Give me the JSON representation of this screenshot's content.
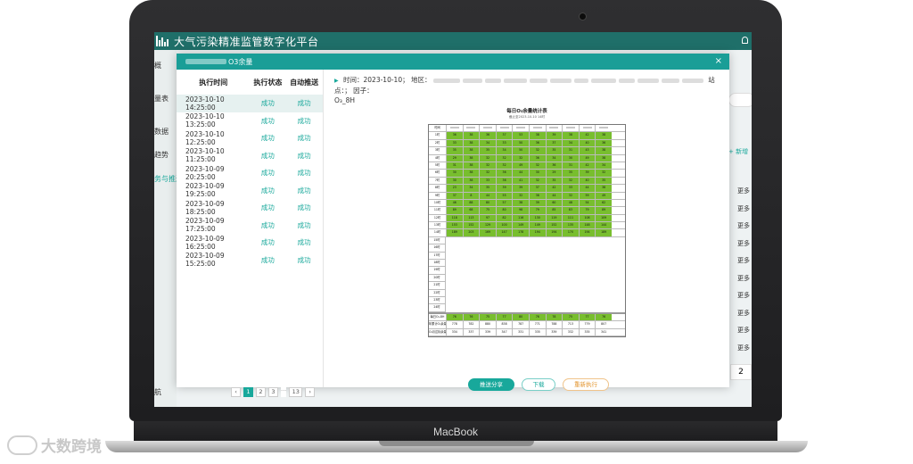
{
  "app": {
    "title": "大气污染精准监管数字化平台"
  },
  "sidebar": {
    "items": [
      {
        "label": "概"
      },
      {
        "label": "量表"
      },
      {
        "label": "数据"
      },
      {
        "label": "趋势"
      },
      {
        "label": "务与推送"
      },
      {
        "label": "航"
      }
    ]
  },
  "background": {
    "add_label": "+ 新增",
    "more_label": "更多",
    "page_label": "2"
  },
  "modal": {
    "title": "O3余量",
    "close": "×",
    "table": {
      "headers": {
        "time": "执行时间",
        "status": "执行状态",
        "push": "自动推送"
      },
      "rows": [
        {
          "time": "2023-10-10 14:25:00",
          "status": "成功",
          "push": "成功"
        },
        {
          "time": "2023-10-10 13:25:00",
          "status": "成功",
          "push": "成功"
        },
        {
          "time": "2023-10-10 12:25:00",
          "status": "成功",
          "push": "成功"
        },
        {
          "time": "2023-10-10 11:25:00",
          "status": "成功",
          "push": "成功"
        },
        {
          "time": "2023-10-09 20:25:00",
          "status": "成功",
          "push": "成功"
        },
        {
          "time": "2023-10-09 19:25:00",
          "status": "成功",
          "push": "成功"
        },
        {
          "time": "2023-10-09 18:25:00",
          "status": "成功",
          "push": "成功"
        },
        {
          "time": "2023-10-09 17:25:00",
          "status": "成功",
          "push": "成功"
        },
        {
          "time": "2023-10-09 16:25:00",
          "status": "成功",
          "push": "成功"
        },
        {
          "time": "2023-10-09 15:25:00",
          "status": "成功",
          "push": "成功"
        }
      ]
    },
    "pagination": {
      "prev": "‹",
      "pages": [
        "1",
        "2",
        "3"
      ],
      "ellipsis": "···",
      "last": "13",
      "next": "›",
      "current": "1"
    },
    "info": {
      "time_label": "时间：",
      "time_value": "2023-10-10；",
      "region_label": "地区：",
      "site_label": "站点：；",
      "factor_label": "因子：",
      "factor_value": "O₃_8H"
    },
    "report": {
      "title": "每日O₃余量统计表",
      "subtitle": "截止至2023-10-10 14时",
      "header_first": "时间",
      "hours": [
        "1时",
        "2时",
        "3时",
        "4时",
        "5时",
        "6时",
        "7时",
        "8时",
        "9时",
        "10时",
        "11时",
        "12时",
        "13时",
        "14时",
        "15时",
        "16时",
        "17时",
        "18时",
        "19时",
        "20时",
        "21时",
        "22时",
        "23时",
        "24时"
      ],
      "data": [
        [
          "36",
          "38",
          "36",
          "37",
          "53",
          "38",
          "39",
          "38",
          "42",
          "38"
        ],
        [
          "33",
          "38",
          "34",
          "33",
          "50",
          "36",
          "37",
          "34",
          "40",
          "36"
        ],
        [
          "35",
          "38",
          "35",
          "34",
          "50",
          "32",
          "35",
          "31",
          "43",
          "38"
        ],
        [
          "29",
          "38",
          "32",
          "32",
          "32",
          "36",
          "34",
          "30",
          "49",
          "38"
        ],
        [
          "31",
          "38",
          "32",
          "32",
          "49",
          "32",
          "36",
          "31",
          "42",
          "34"
        ],
        [
          "30",
          "38",
          "32",
          "36",
          "44",
          "30",
          "29",
          "35",
          "39",
          "32"
        ],
        [
          "30",
          "38",
          "33",
          "36",
          "41",
          "32",
          "35",
          "32",
          "40",
          "35"
        ],
        [
          "23",
          "34",
          "35",
          "39",
          "39",
          "37",
          "42",
          "33",
          "44",
          "38"
        ],
        [
          "37",
          "8",
          "44",
          "55",
          "32",
          "38",
          "44",
          "32",
          "59",
          "49"
        ],
        [
          "46",
          "88",
          "80",
          "57",
          "38",
          "39",
          "60",
          "48",
          "54",
          "62"
        ],
        [
          "89",
          "68",
          "75",
          "80",
          "98",
          "79",
          "85",
          "83",
          "79",
          "89"
        ],
        [
          "118",
          "113",
          "97",
          "82",
          "116",
          "130",
          "119",
          "111",
          "108",
          "109"
        ],
        [
          "153",
          "152",
          "129",
          "100",
          "149",
          "149",
          "152",
          "135",
          "148",
          "144"
        ],
        [
          "189",
          "203",
          "169",
          "147",
          "178",
          "194",
          "194",
          "170",
          "194",
          "189"
        ]
      ],
      "footer_rows": [
        {
          "label": "每日O₃-8H",
          "values": [
            "76",
            "76",
            "75",
            "77",
            "80",
            "76",
            "78",
            "75",
            "77",
            "76"
          ]
        },
        {
          "label": "年累计O₃余量",
          "values": [
            "778",
            "782",
            "880",
            "838",
            "787",
            "771",
            "788",
            "713",
            "779",
            "807"
          ]
        },
        {
          "label": "O₃月达标余量",
          "values": [
            "334",
            "337",
            "339",
            "347",
            "331",
            "335",
            "339",
            "332",
            "335",
            "341"
          ]
        }
      ]
    },
    "buttons": {
      "push": "推送分享",
      "download": "下载",
      "rerun": "重新执行"
    }
  },
  "laptop": {
    "brand": "MacBook"
  },
  "watermark": {
    "text": "大数跨境"
  }
}
